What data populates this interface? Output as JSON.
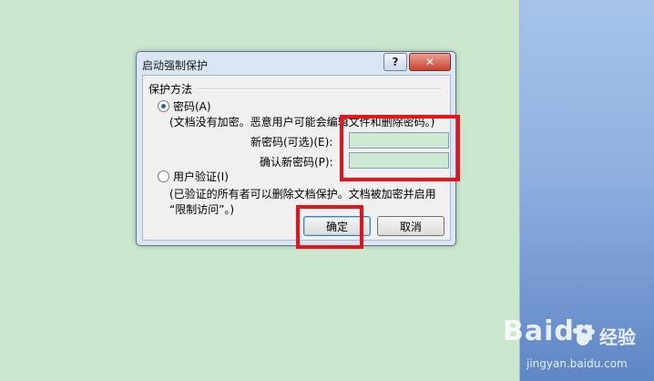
{
  "dialog": {
    "title": "启动强制保护",
    "help_label": "?",
    "close_label": "✕",
    "group_label": "保护方法",
    "password_option": "密码(A)",
    "password_desc": "(文档没有加密。恶意用户可能会编辑文件和删除密码。)",
    "new_password_label": "新密码(可选)(E):",
    "confirm_password_label": "确认新密码(P):",
    "new_password_value": "",
    "confirm_password_value": "",
    "user_auth_option": "用户验证(I)",
    "user_auth_desc_line1": "(已验证的所有者可以删除文档保护。文档被加密并启用",
    "user_auth_desc_line2": "“限制访问”。)",
    "ok_label": "确定",
    "cancel_label": "取消",
    "selected_method": "password"
  },
  "watermark": {
    "logo": "Baidu",
    "cn": "经验",
    "url": "jingyan.baidu.com"
  },
  "colors": {
    "highlight": "#e8121b",
    "doc_background": "#cbe8cf",
    "field_fill": "#cde9d1"
  }
}
